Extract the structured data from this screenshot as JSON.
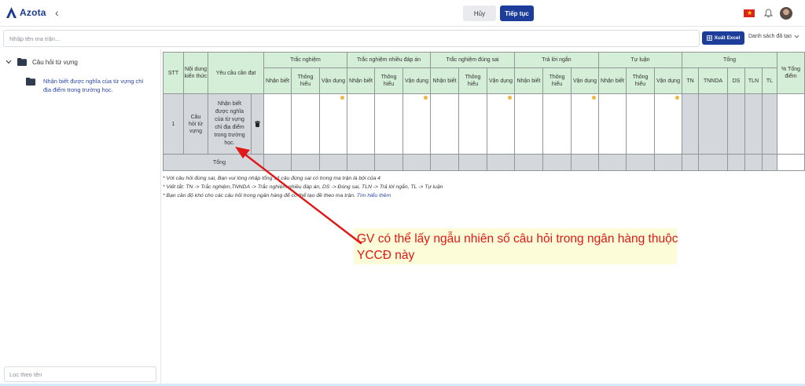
{
  "app": {
    "logo_text": "Azota"
  },
  "header": {
    "cancel_label": "Hủy",
    "continue_label": "Tiếp tục"
  },
  "toolbar": {
    "search_placeholder": "Nhập tên ma trận...",
    "excel_label": "Xuất Excel",
    "created_list_label": "Danh sách đã tạo"
  },
  "sidebar": {
    "root_label": "Câu hỏi từ vựng",
    "child_label": "Nhận biết được nghĩa của từ vựng chỉ địa điểm trong trường học.",
    "filter_placeholder": "Lọc theo tên"
  },
  "table": {
    "headers": {
      "stt": "STT",
      "content": "Nội dung kiến thức",
      "requirement": "Yêu cầu cần đạt",
      "groups": [
        "Trắc nghiệm",
        "Trắc nghiệm nhiều đáp án",
        "Trắc nghiệm đúng sai",
        "Trả lời ngắn",
        "Tự luận"
      ],
      "levels": [
        "Nhận biết",
        "Thông hiểu",
        "Vận dụng"
      ],
      "total": "Tổng",
      "total_cols": [
        "TN",
        "TNNDA",
        "DS",
        "TLN",
        "TL"
      ],
      "percent": "% Tổng điểm"
    },
    "rows": [
      {
        "stt": "1",
        "content": "Câu hỏi từ vựng",
        "requirement": "Nhận biết được nghĩa của từ vựng chỉ địa điểm trong trường học."
      }
    ],
    "total_row_label": "Tổng"
  },
  "notes": {
    "line1": "* Với câu hỏi đúng sai, Bạn vui lòng nhập tổng số câu đúng sai có trong ma trận là bội của 4",
    "line2": "* Viết tắt: TN -> Trắc nghiệm,TNNDA -> Trắc nghiệm nhiều đáp án, DS -> Đúng sai, TLN -> Trả lời ngắn, TL -> Tự luận",
    "line3": "* Bạn cần độ khó cho các câu hỏi trong ngân hàng để có thể tạo đề theo ma trận.",
    "link": "Tìm hiểu thêm"
  },
  "annotation": {
    "text": "GV có thể lấy ngẫu nhiên số câu hỏi trong ngân hàng thuộc YCCĐ này"
  },
  "colors": {
    "primary": "#1c3d9a",
    "header_green": "#d5eed7",
    "cell_gray": "#d4d8dd",
    "annotation_red": "#e01818",
    "annotation_bg": "#fdfcd8",
    "difficulty_dot": "#f3b53a"
  }
}
